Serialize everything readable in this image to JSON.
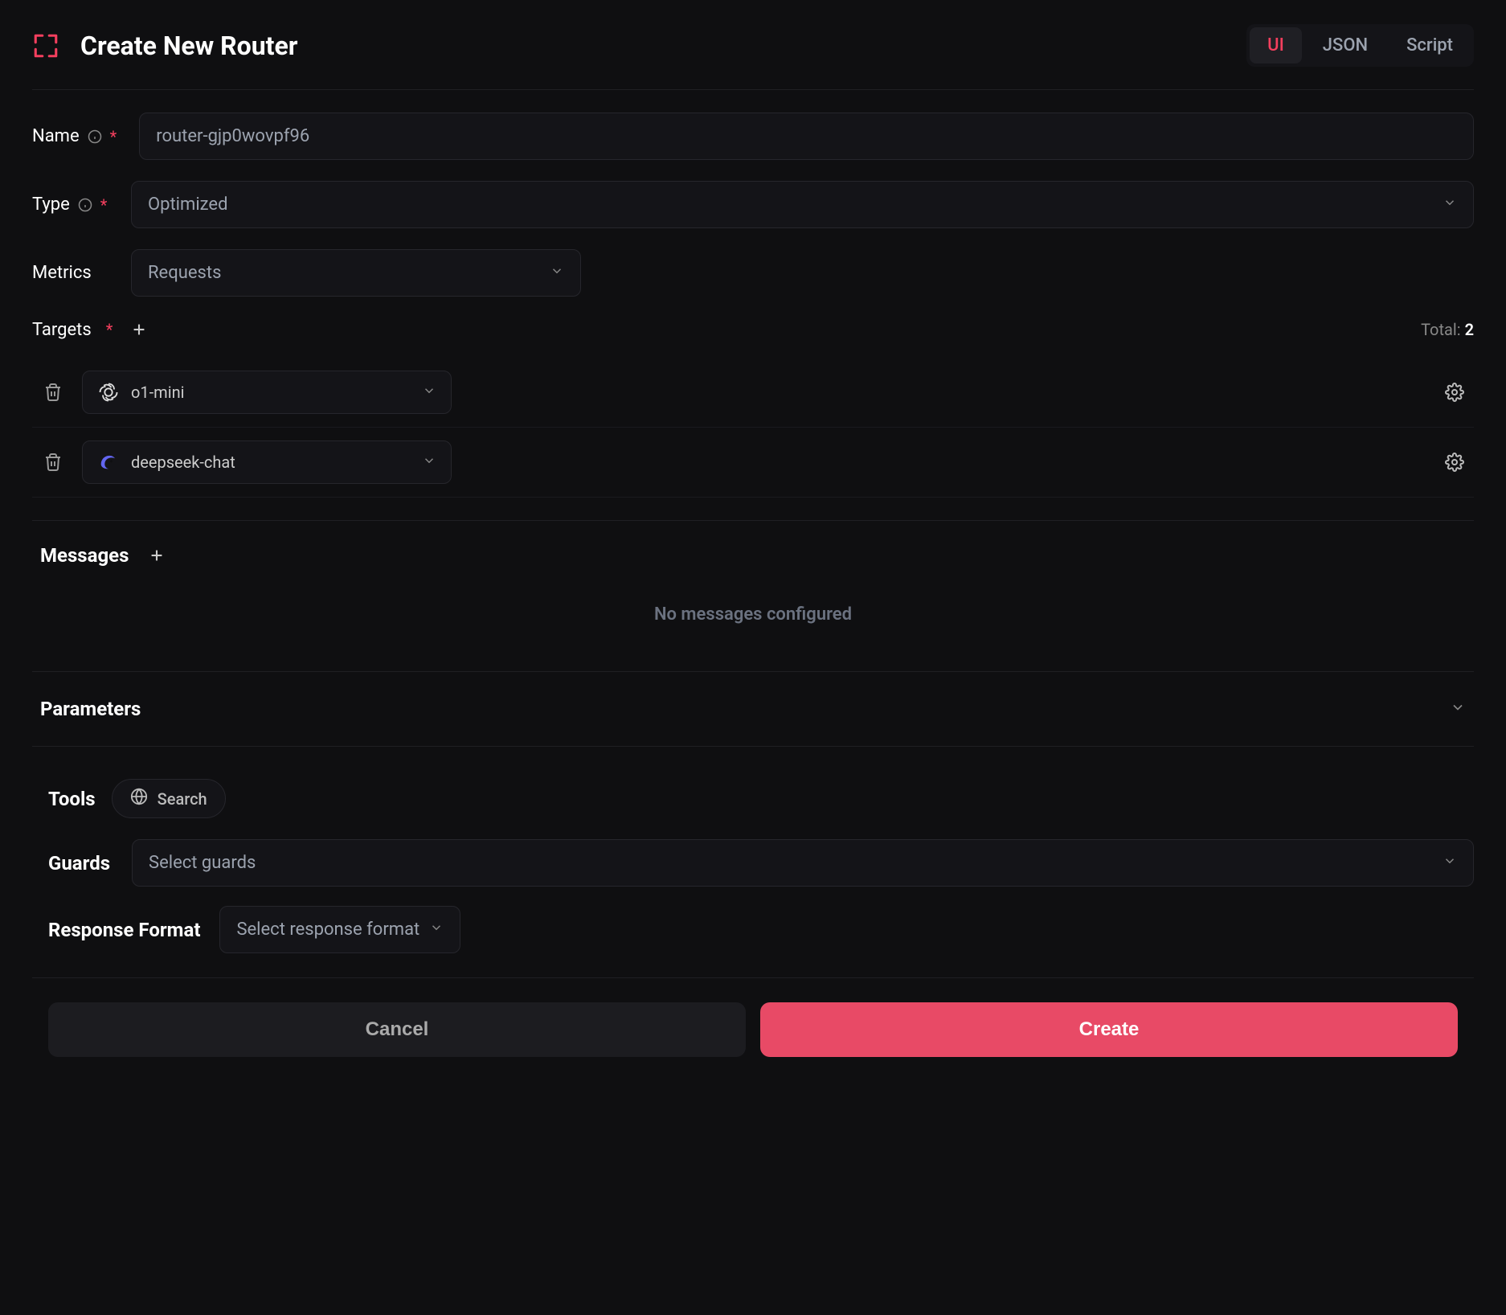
{
  "header": {
    "title": "Create New Router",
    "tabs": [
      {
        "label": "UI",
        "active": true
      },
      {
        "label": "JSON",
        "active": false
      },
      {
        "label": "Script",
        "active": false
      }
    ]
  },
  "form": {
    "name_label": "Name",
    "name_value": "router-gjp0wovpf96",
    "type_label": "Type",
    "type_value": "Optimized",
    "metrics_label": "Metrics",
    "metrics_value": "Requests"
  },
  "targets": {
    "label": "Targets",
    "total_label": "Total: ",
    "total": "2",
    "items": [
      {
        "model": "o1-mini",
        "provider": "openai"
      },
      {
        "model": "deepseek-chat",
        "provider": "deepseek"
      }
    ]
  },
  "messages": {
    "label": "Messages",
    "empty": "No messages configured"
  },
  "parameters": {
    "label": "Parameters"
  },
  "tools": {
    "label": "Tools",
    "chip": "Search"
  },
  "guards": {
    "label": "Guards",
    "placeholder": "Select guards"
  },
  "response_format": {
    "label": "Response Format",
    "placeholder": "Select response format"
  },
  "footer": {
    "cancel": "Cancel",
    "create": "Create"
  }
}
